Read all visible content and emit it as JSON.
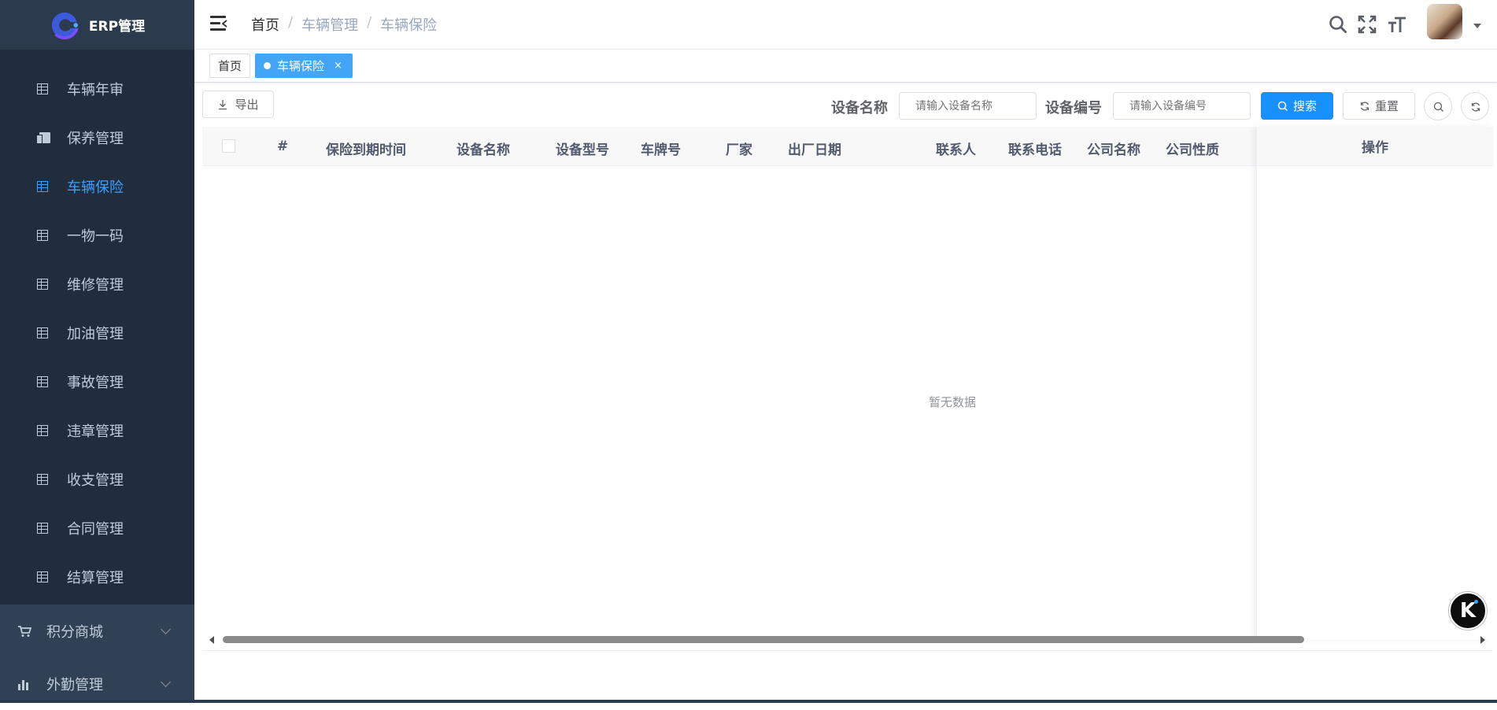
{
  "app": {
    "title": "ERP管理"
  },
  "sidebar": {
    "items": [
      {
        "label": "车辆年审",
        "icon": "table-icon",
        "active": false
      },
      {
        "label": "保养管理",
        "icon": "documents-icon",
        "active": false
      },
      {
        "label": "车辆保险",
        "icon": "table-icon",
        "active": true
      },
      {
        "label": "一物一码",
        "icon": "table-icon",
        "active": false
      },
      {
        "label": "维修管理",
        "icon": "table-icon",
        "active": false
      },
      {
        "label": "加油管理",
        "icon": "table-icon",
        "active": false
      },
      {
        "label": "事故管理",
        "icon": "table-icon",
        "active": false
      },
      {
        "label": "违章管理",
        "icon": "table-icon",
        "active": false
      },
      {
        "label": "收支管理",
        "icon": "table-icon",
        "active": false
      },
      {
        "label": "合同管理",
        "icon": "table-icon",
        "active": false
      },
      {
        "label": "结算管理",
        "icon": "table-icon",
        "active": false
      }
    ],
    "groups": [
      {
        "label": "积分商城",
        "icon": "cart-icon"
      },
      {
        "label": "外勤管理",
        "icon": "bar-chart-icon"
      }
    ]
  },
  "header": {
    "breadcrumb": [
      "首页",
      "车辆管理",
      "车辆保险"
    ],
    "separator": "/"
  },
  "tags": [
    {
      "label": "首页",
      "active": false
    },
    {
      "label": "车辆保险",
      "active": true,
      "close": "×"
    }
  ],
  "toolbar": {
    "export_label": "导出",
    "search_label": "搜索",
    "reset_label": "重置"
  },
  "filters": {
    "device_name": {
      "label": "设备名称",
      "placeholder": "请输入设备名称",
      "value": ""
    },
    "device_code": {
      "label": "设备编号",
      "placeholder": "请输入设备编号",
      "value": ""
    }
  },
  "table": {
    "columns": [
      "#",
      "保险到期时间",
      "设备名称",
      "设备型号",
      "车牌号",
      "厂家",
      "出厂日期",
      "联系人",
      "联系电话",
      "公司名称",
      "公司性质"
    ],
    "fixed_column": "操作",
    "rows": [],
    "empty_text": "暂无数据"
  },
  "floating_button": {
    "label": "K"
  },
  "colors": {
    "sidebar_bg": "#304156",
    "menu_bg": "#1f2d3d",
    "accent": "#409eff",
    "primary_button": "#1890ff",
    "tag_active": "#42a5f5"
  }
}
